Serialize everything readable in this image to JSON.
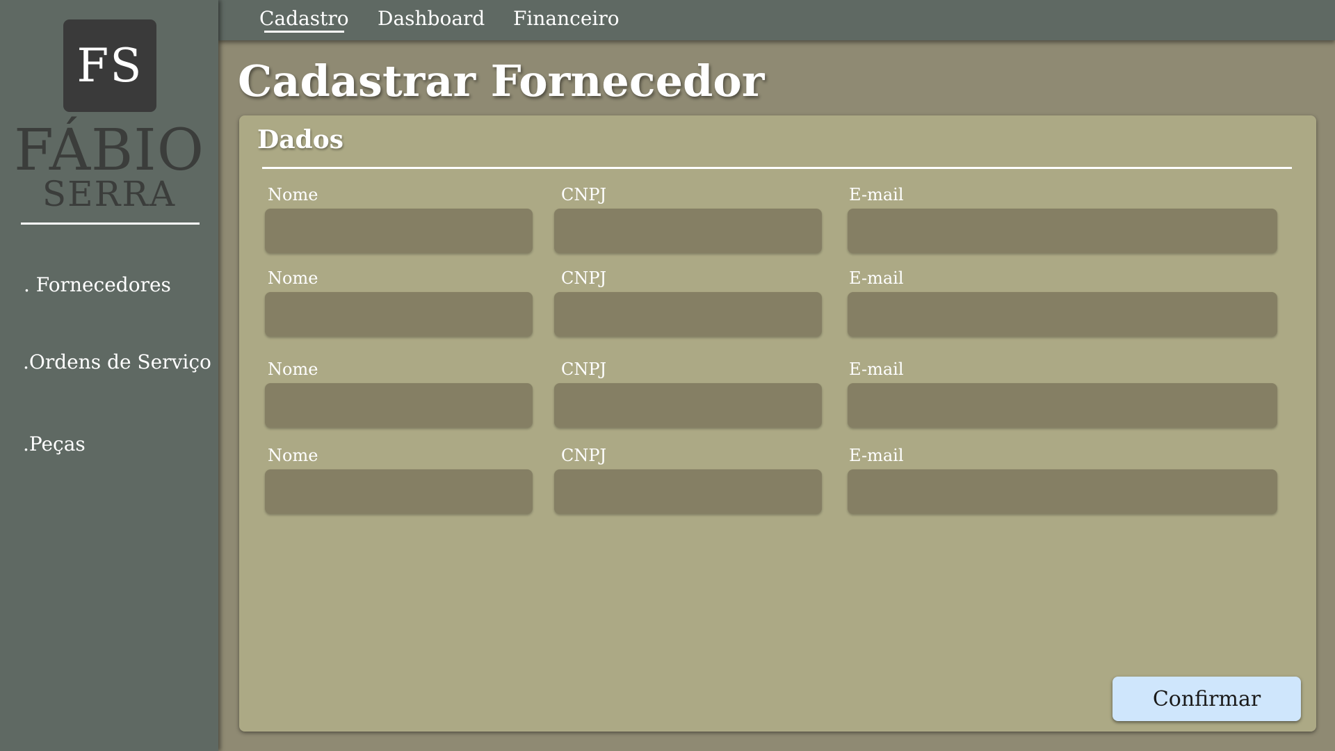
{
  "brand": {
    "logo_initials": "FS",
    "name": "FÁBIO",
    "surname": "SERRA"
  },
  "sidebar": {
    "items": [
      {
        "label": ". Fornecedores"
      },
      {
        "label": ".Ordens de Serviço"
      },
      {
        "label": ".Peças"
      }
    ]
  },
  "topnav": {
    "tabs": [
      {
        "label": "Cadastro",
        "active": true
      },
      {
        "label": "Dashboard",
        "active": false
      },
      {
        "label": "Financeiro",
        "active": false
      }
    ]
  },
  "page": {
    "title": "Cadastrar Fornecedor"
  },
  "form": {
    "section_title": "Dados",
    "rows": [
      {
        "nome_label": "Nome",
        "nome_value": "",
        "cnpj_label": "CNPJ",
        "cnpj_value": "",
        "email_label": "E-mail",
        "email_value": ""
      },
      {
        "nome_label": "Nome",
        "nome_value": "",
        "cnpj_label": "CNPJ",
        "cnpj_value": "",
        "email_label": "E-mail",
        "email_value": ""
      },
      {
        "nome_label": "Nome",
        "nome_value": "",
        "cnpj_label": "CNPJ",
        "cnpj_value": "",
        "email_label": "E-mail",
        "email_value": ""
      },
      {
        "nome_label": "Nome",
        "nome_value": "",
        "cnpj_label": "CNPJ",
        "cnpj_value": "",
        "email_label": "E-mail",
        "email_value": ""
      }
    ],
    "confirm_label": "Confirmar"
  },
  "colors": {
    "sidebar_bg": "#5f6963",
    "page_bg": "#8f8a73",
    "card_bg": "#aca985",
    "input_bg": "#857f64",
    "button_bg": "#cfe6fc"
  }
}
